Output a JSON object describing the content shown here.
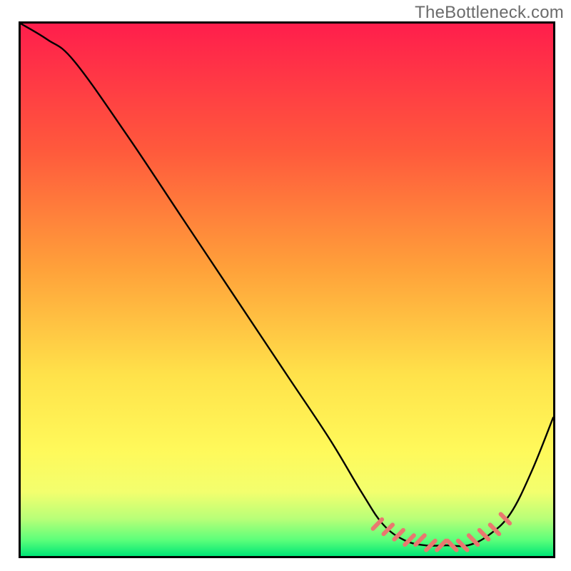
{
  "watermark": "TheBottleneck.com",
  "chart_data": {
    "type": "line",
    "title": "",
    "xlabel": "",
    "ylabel": "",
    "xlim": [
      0,
      100
    ],
    "ylim": [
      0,
      100
    ],
    "grid": false,
    "legend": false,
    "gradient_stops": [
      {
        "offset": 0,
        "color": "#ff1e4c"
      },
      {
        "offset": 0.24,
        "color": "#ff5a3c"
      },
      {
        "offset": 0.46,
        "color": "#ffa13a"
      },
      {
        "offset": 0.66,
        "color": "#ffe24a"
      },
      {
        "offset": 0.8,
        "color": "#fff95a"
      },
      {
        "offset": 0.88,
        "color": "#f3ff6e"
      },
      {
        "offset": 0.93,
        "color": "#b8ff78"
      },
      {
        "offset": 0.97,
        "color": "#5cff7a"
      },
      {
        "offset": 1.0,
        "color": "#00e676"
      }
    ],
    "series": [
      {
        "name": "bottleneck-curve",
        "color": "#000000",
        "x": [
          0,
          5,
          10,
          20,
          30,
          40,
          50,
          58,
          64,
          68,
          72,
          76,
          80,
          84,
          88,
          92,
          96,
          100
        ],
        "y": [
          100,
          97,
          93,
          79,
          64,
          49,
          34,
          22,
          12,
          6,
          3,
          2,
          2,
          2,
          4,
          8,
          16,
          26
        ]
      },
      {
        "name": "optimal-markers",
        "type": "scatter",
        "color": "#e9786f",
        "x": [
          67,
          69,
          71,
          73,
          75,
          77,
          79,
          81,
          83,
          85,
          87,
          89,
          91
        ],
        "y": [
          6,
          5,
          4,
          3,
          3,
          2,
          2,
          2,
          2,
          3,
          4,
          5,
          7
        ]
      }
    ]
  }
}
